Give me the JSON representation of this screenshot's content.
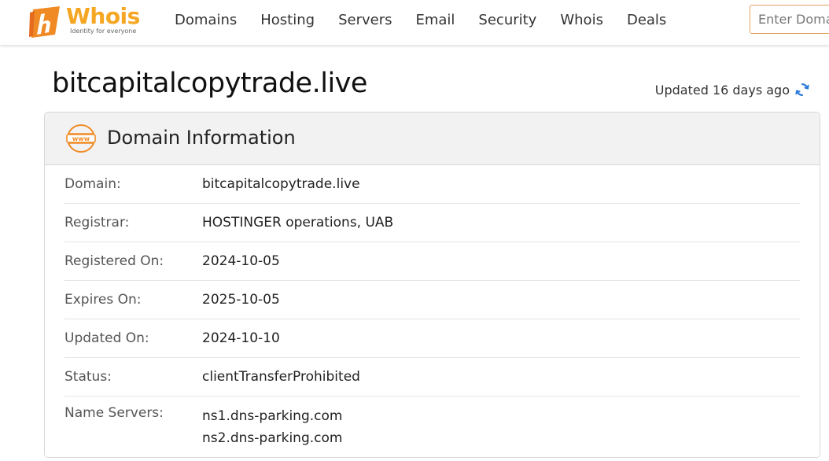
{
  "header": {
    "logo": {
      "brand": "Whois",
      "tagline": "Identity for everyone",
      "brand_color": "#f5a623"
    },
    "nav": [
      "Domains",
      "Hosting",
      "Servers",
      "Email",
      "Security",
      "Whois",
      "Deals"
    ],
    "search": {
      "placeholder": "Enter Domain",
      "value": ""
    }
  },
  "page": {
    "title": "bitcapitalcopytrade.live",
    "updated_text": "Updated 16 days ago",
    "refresh_icon": "refresh-icon",
    "accent_color": "#2b7bd8"
  },
  "card": {
    "icon": "www-icon",
    "title": "Domain Information",
    "rows": [
      {
        "label": "Domain:",
        "value": "bitcapitalcopytrade.live"
      },
      {
        "label": "Registrar:",
        "value": "HOSTINGER operations, UAB"
      },
      {
        "label": "Registered On:",
        "value": "2024-10-05"
      },
      {
        "label": "Expires On:",
        "value": "2025-10-05"
      },
      {
        "label": "Updated On:",
        "value": "2024-10-10"
      },
      {
        "label": "Status:",
        "value": "clientTransferProhibited"
      }
    ],
    "name_servers": {
      "label": "Name Servers:",
      "values": [
        "ns1.dns-parking.com",
        "ns2.dns-parking.com"
      ]
    }
  }
}
